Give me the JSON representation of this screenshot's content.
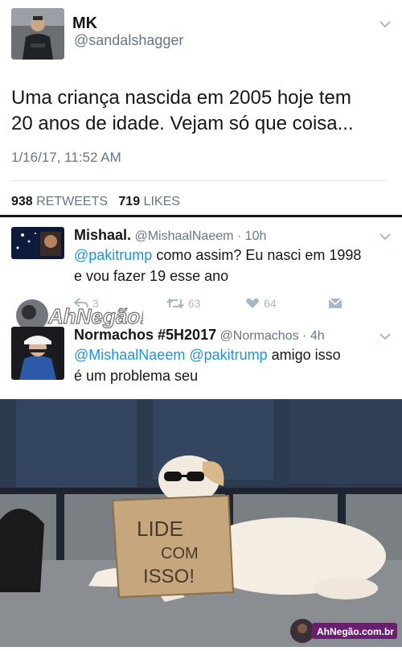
{
  "tweet": {
    "name": "MK",
    "handle": "@sandalshagger",
    "text_line1": "Uma criança nascida em 2005 hoje tem",
    "text_line2": "20 anos de idade. Vejam só que coisa...",
    "timestamp": "1/16/17, 11:52 AM",
    "retweets_count": "938",
    "retweets_label": "RETWEETS",
    "likes_count": "719",
    "likes_label": "LIKES"
  },
  "replies": [
    {
      "name": "Mishaal.",
      "handle": "@MishaalNaeem",
      "time": "· 10h",
      "mention": "@pakitrump",
      "text_rest": " como assim? Eu nasci em 1998",
      "text_line2": "e vou fazer 19 esse ano",
      "reply_count": "3",
      "retweet_count": "63",
      "like_count": "64"
    },
    {
      "name": "Normachos #5H2017",
      "handle": "@Normachos",
      "time": "· 4h",
      "mention1": "@MishaalNaeem",
      "mention2": "@pakitrump",
      "text_rest": " amigo isso",
      "text_line2": "é um problema seu"
    }
  ],
  "watermark": {
    "logo_text": "AhNegão!",
    "site": "AhNegão.com.br"
  },
  "photo": {
    "sign_line1": "LIDE",
    "sign_line2": "COM",
    "sign_line3": "ISSO!"
  },
  "colors": {
    "link": "#1b95e0",
    "muted": "#657786",
    "icon": "#aab8c2"
  }
}
